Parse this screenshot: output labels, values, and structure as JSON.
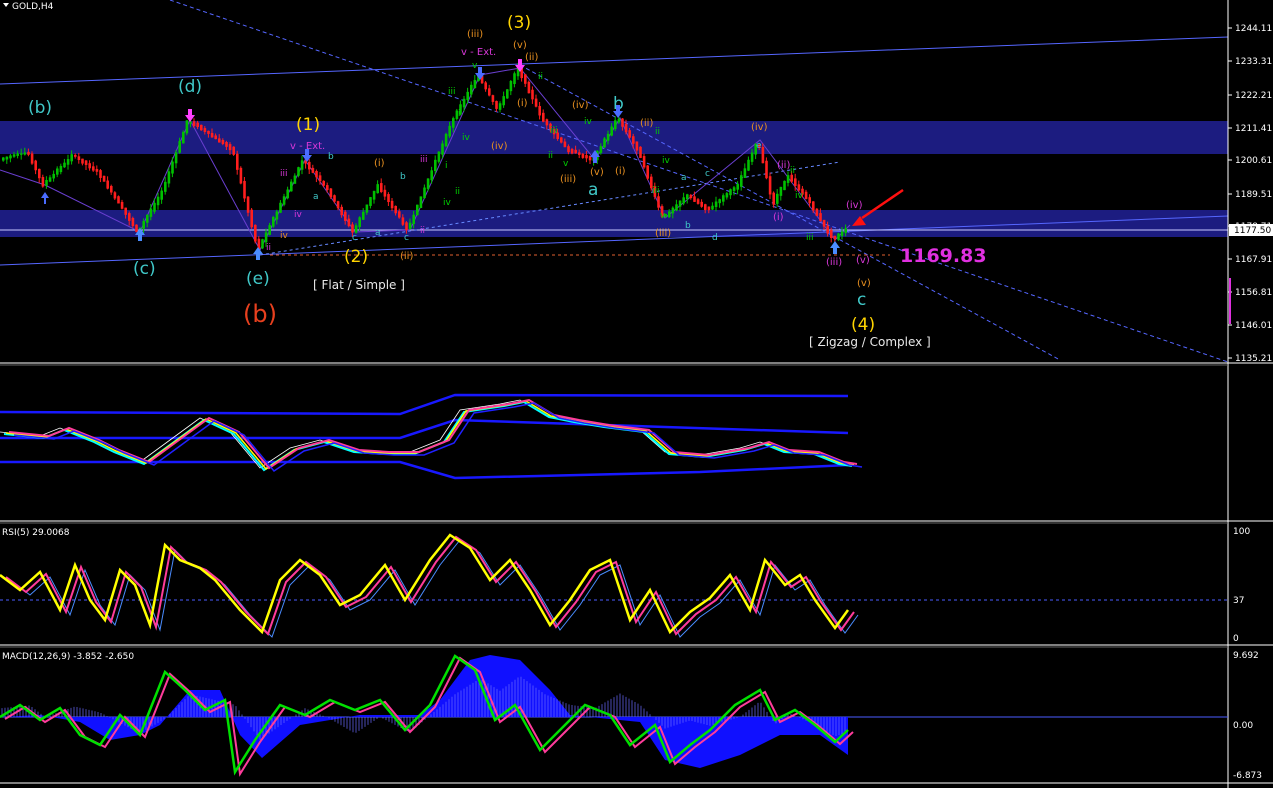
{
  "window": {
    "symbol_title": "GOLD,H4"
  },
  "colors": {
    "background": "#000000",
    "bull": "#00c000",
    "bear": "#ff1e1e",
    "zone": "#1a1a7a",
    "channel": "#4a5cff",
    "label_cyan": "#40c8c8",
    "label_yellow": "#ffd400",
    "label_orange": "#e89020",
    "label_magenta": "#d838d8",
    "label_red": "#e8401e",
    "arrow_red": "#ff1010",
    "rsi": "#ffff00",
    "macd_line": "#00e000",
    "signal": "#ff3c9b",
    "hist": "#1010ff"
  },
  "main": {
    "price_axis": [
      "1244.11",
      "1233.31",
      "1222.21",
      "1211.41",
      "1200.61",
      "1189.51",
      "1178.71",
      "1167.91",
      "1156.81",
      "1146.01",
      "1135.21"
    ],
    "current_price": "1177.50",
    "target_price": "1169.83",
    "wave_labels": {
      "b_small": "(b)",
      "c_small": "(c)",
      "d_small": "(d)",
      "e_small": "(e)",
      "b_big": "(b)",
      "w1": "(1)",
      "w2": "(2)",
      "w3": "(3)",
      "w4": "(4)",
      "a_big": "a",
      "b_big_cyan": "b",
      "c_big": "c",
      "flat_note": "[ Flat / Simple ]",
      "zigzag_note": "[ Zigzag / Complex ]",
      "ext1": "v - Ext.",
      "ext2": "v - Ext.",
      "iii": "iii",
      "iv": "iv",
      "v": "v",
      "ii": "ii",
      "i": "i",
      "p_i": "(i)",
      "p_ii": "(ii)",
      "p_iii": "(iii)",
      "p_iv": "(iv)",
      "p_v": "(v)",
      "a": "a",
      "b": "b",
      "c": "c",
      "d": "d",
      "e": "e"
    }
  },
  "rsi": {
    "title": "RSI(5) 29.0068",
    "levels": [
      "100",
      "37",
      "0"
    ]
  },
  "macd": {
    "title": "MACD(12,26,9) -3.852 -2.650",
    "levels": [
      "9.692",
      "0.00",
      "-6.873"
    ]
  }
}
